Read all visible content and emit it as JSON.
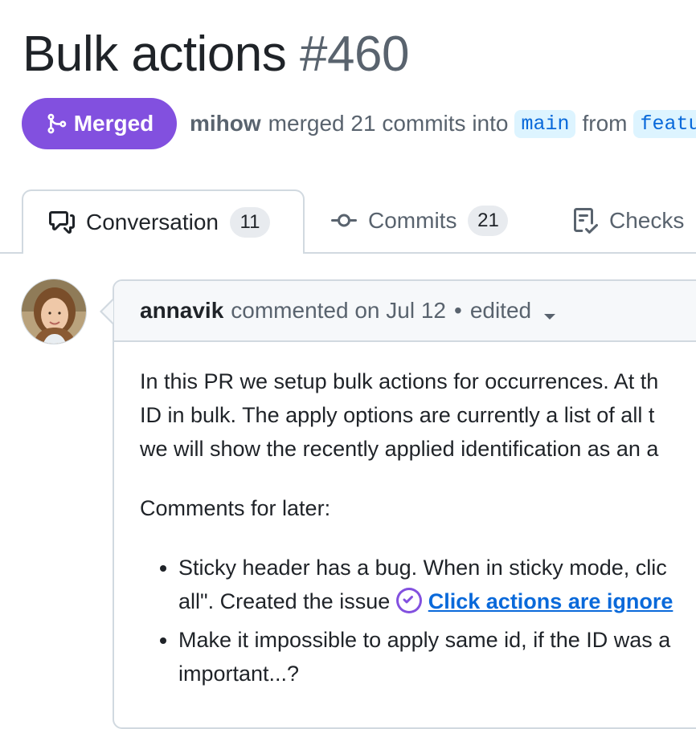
{
  "pr": {
    "title": "Bulk actions",
    "number": "#460",
    "state": "Merged",
    "merged_by": "mihow",
    "merge_text": "merged 21 commits into",
    "base_branch": "main",
    "from_text": "from",
    "head_branch": "featu"
  },
  "tabs": [
    {
      "label": "Conversation",
      "count": "11",
      "icon": "comment-discussion-icon"
    },
    {
      "label": "Commits",
      "count": "21",
      "icon": "git-commit-icon"
    },
    {
      "label": "Checks",
      "icon": "checklist-icon"
    }
  ],
  "comment": {
    "author": "annavik",
    "action": "commented on Jul 12",
    "separator": "•",
    "edited": "edited",
    "body": {
      "line1": "In this PR we setup bulk actions for occurrences. At th",
      "line2": "ID in bulk. The apply options are currently a list of all t",
      "line3": "we will show the recently applied identification as an a",
      "comments_heading": "Comments for later:",
      "bullet1_line1": "Sticky header has a bug. When in sticky mode, clic",
      "bullet1_line2": "all\". Created the issue",
      "bullet1_link": "Click actions are ignore",
      "bullet2_line1": "Make it impossible to apply same id, if the ID was a",
      "bullet2_line2": "important...?"
    }
  },
  "colors": {
    "merged": "#8250df",
    "link": "#0969da",
    "muted": "#59636e",
    "border": "#d1d9e0"
  }
}
